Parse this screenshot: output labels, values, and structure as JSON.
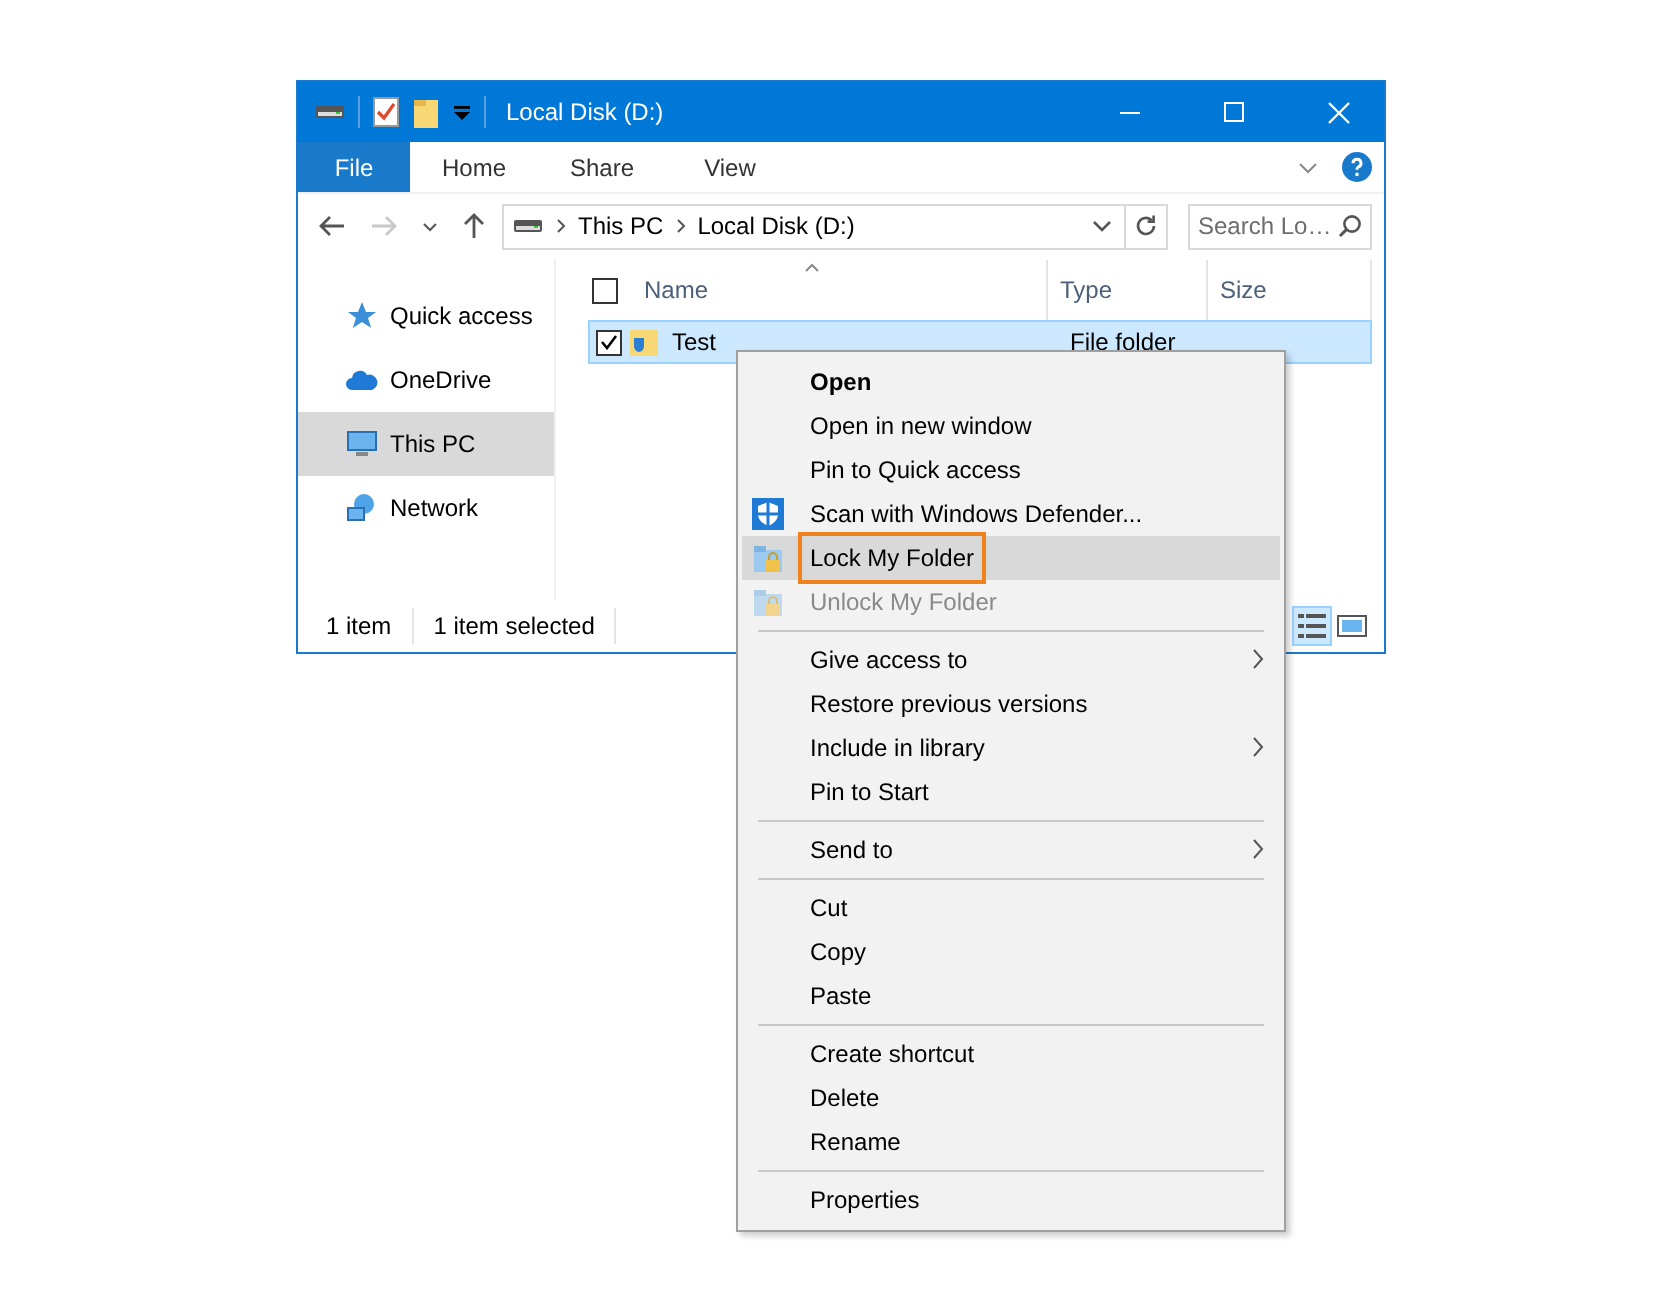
{
  "window": {
    "title": "Local Disk (D:)"
  },
  "ribbon_tabs": [
    {
      "label": "File",
      "kind": "file"
    },
    {
      "label": "Home",
      "kind": "tab"
    },
    {
      "label": "Share",
      "kind": "tab"
    },
    {
      "label": "View",
      "kind": "tab"
    }
  ],
  "address": {
    "forward_disabled": true,
    "breadcrumbs": [
      "This PC",
      "Local Disk (D:)"
    ]
  },
  "search": {
    "placeholder": "Search Lo…"
  },
  "navigation": [
    {
      "label": "Quick access",
      "kind": "star",
      "selected": false
    },
    {
      "label": "OneDrive",
      "kind": "cloud",
      "selected": false
    },
    {
      "label": "This PC",
      "kind": "monitor",
      "selected": true
    },
    {
      "label": "Network",
      "kind": "network",
      "selected": false
    }
  ],
  "columns": [
    "Name",
    "Type",
    "Size"
  ],
  "select_all_checked": false,
  "rows": [
    {
      "name": "Test",
      "type": "File folder",
      "checked": true,
      "selected": true
    }
  ],
  "status_bar": {
    "item_count": "1 item",
    "selection": "1 item selected"
  },
  "view_buttons": [
    {
      "kind": "details",
      "selected": true
    },
    {
      "kind": "large-icons",
      "selected": false
    }
  ],
  "context_menu": [
    {
      "kind": "item",
      "label": "Open",
      "bold": true,
      "disabled": false,
      "selected": false,
      "outlined": false,
      "submenu": false
    },
    {
      "kind": "item",
      "label": "Open in new window",
      "bold": false,
      "disabled": false,
      "selected": false,
      "outlined": false,
      "submenu": false
    },
    {
      "kind": "item",
      "label": "Pin to Quick access",
      "bold": false,
      "disabled": false,
      "selected": false,
      "outlined": false,
      "submenu": false
    },
    {
      "kind": "shield",
      "label": "Scan with Windows Defender...",
      "bold": false,
      "disabled": false,
      "selected": false,
      "outlined": false,
      "submenu": false
    },
    {
      "kind": "lock",
      "label": "Lock My Folder",
      "bold": false,
      "disabled": false,
      "selected": true,
      "outlined": true,
      "submenu": false
    },
    {
      "kind": "lock",
      "label": "Unlock My Folder",
      "bold": false,
      "disabled": true,
      "selected": false,
      "outlined": false,
      "submenu": false
    },
    {
      "kind": "separator"
    },
    {
      "kind": "item",
      "label": "Give access to",
      "bold": false,
      "disabled": false,
      "selected": false,
      "outlined": false,
      "submenu": true
    },
    {
      "kind": "item",
      "label": "Restore previous versions",
      "bold": false,
      "disabled": false,
      "selected": false,
      "outlined": false,
      "submenu": false
    },
    {
      "kind": "item",
      "label": "Include in library",
      "bold": false,
      "disabled": false,
      "selected": false,
      "outlined": false,
      "submenu": true
    },
    {
      "kind": "item",
      "label": "Pin to Start",
      "bold": false,
      "disabled": false,
      "selected": false,
      "outlined": false,
      "submenu": false
    },
    {
      "kind": "separator"
    },
    {
      "kind": "item",
      "label": "Send to",
      "bold": false,
      "disabled": false,
      "selected": false,
      "outlined": false,
      "submenu": true
    },
    {
      "kind": "separator"
    },
    {
      "kind": "item",
      "label": "Cut",
      "bold": false,
      "disabled": false,
      "selected": false,
      "outlined": false,
      "submenu": false
    },
    {
      "kind": "item",
      "label": "Copy",
      "bold": false,
      "disabled": false,
      "selected": false,
      "outlined": false,
      "submenu": false
    },
    {
      "kind": "item",
      "label": "Paste",
      "bold": false,
      "disabled": false,
      "selected": false,
      "outlined": false,
      "submenu": false
    },
    {
      "kind": "separator"
    },
    {
      "kind": "item",
      "label": "Create shortcut",
      "bold": false,
      "disabled": false,
      "selected": false,
      "outlined": false,
      "submenu": false
    },
    {
      "kind": "item",
      "label": "Delete",
      "bold": false,
      "disabled": false,
      "selected": false,
      "outlined": false,
      "submenu": false
    },
    {
      "kind": "item",
      "label": "Rename",
      "bold": false,
      "disabled": false,
      "selected": false,
      "outlined": false,
      "submenu": false
    },
    {
      "kind": "separator"
    },
    {
      "kind": "item",
      "label": "Properties",
      "bold": false,
      "disabled": false,
      "selected": false,
      "outlined": false,
      "submenu": false
    }
  ]
}
